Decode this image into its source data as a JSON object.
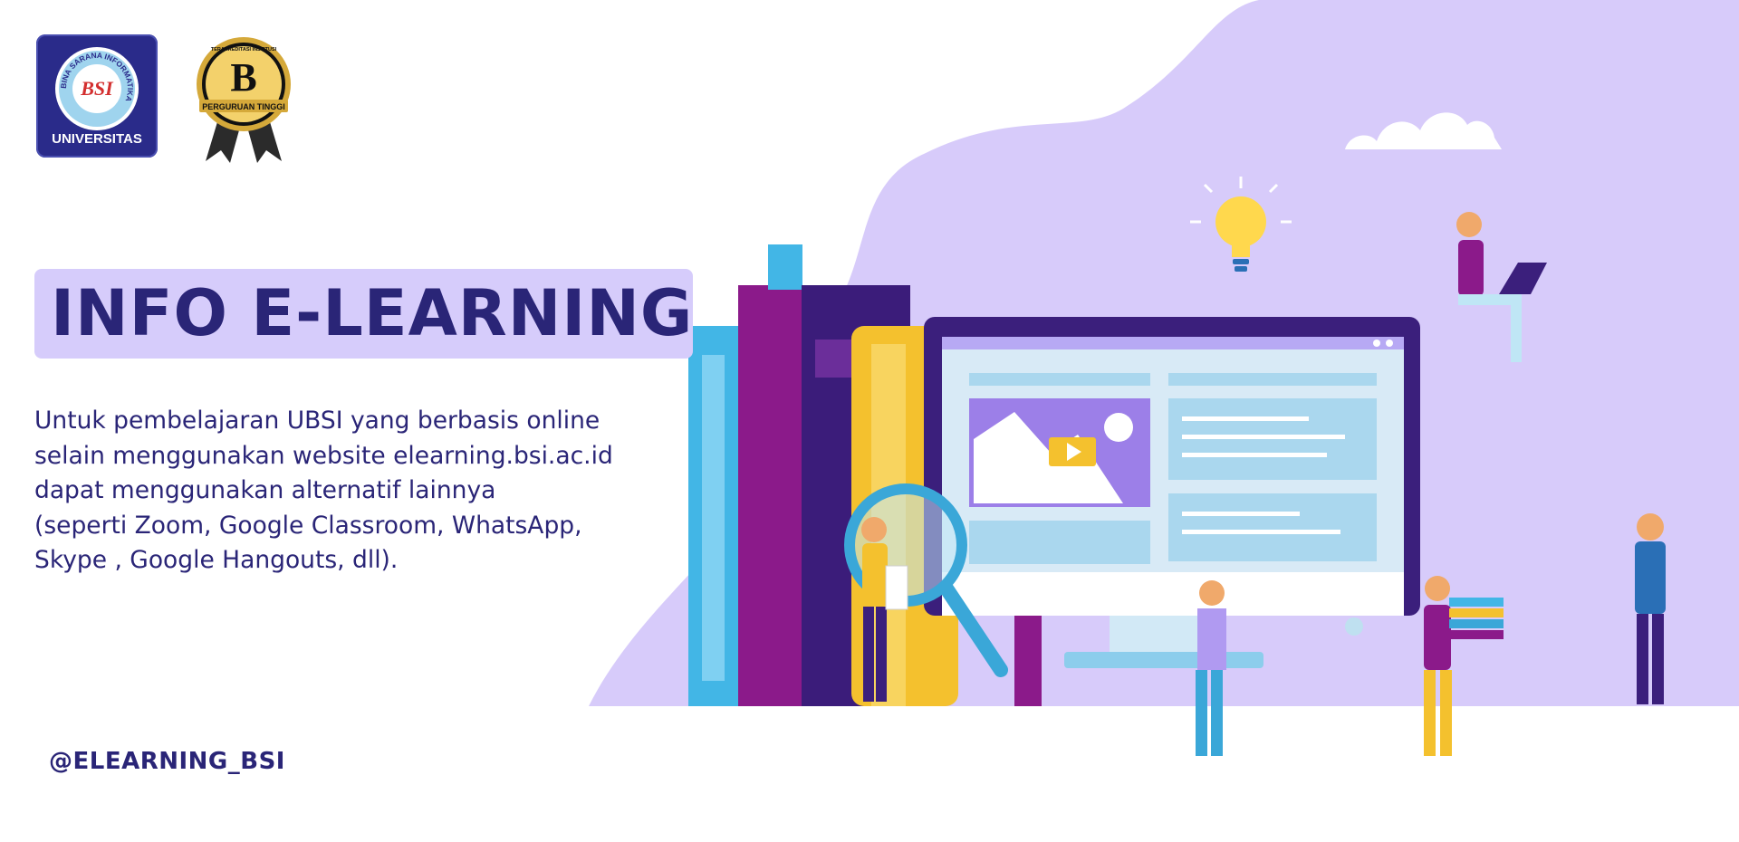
{
  "logos": {
    "university_ring_text": "BINA SARANA INFORMATIKA",
    "university_mark": "BSI",
    "university_label": "UNIVERSITAS",
    "accreditation_top": "TERAKREDITASI INSTITUSI",
    "accreditation_grade": "B",
    "accreditation_label": "PERGURUAN TINGGI"
  },
  "title": "INFO E-LEARNING",
  "description_lines": [
    "Untuk pembelajaran UBSI yang berbasis online",
    "selain menggunakan website elearning.bsi.ac.id",
    "dapat menggunakan alternatif lainnya",
    "(seperti Zoom, Google Classroom, WhatsApp,",
    "Skype , Google Hangouts, dll)."
  ],
  "handle": "@ELEARNING_BSI",
  "colors": {
    "primary_navy": "#2a2577",
    "title_highlight": "#d6ccfb",
    "blob_lavender": "#d7cbfa",
    "logo_blue": "#2a2b8a"
  },
  "illustration_icons": [
    "lightbulb-icon",
    "cloud-icon",
    "monitor-icon",
    "books-icon",
    "magnifier-icon",
    "image-placeholder-icon",
    "play-icon"
  ]
}
